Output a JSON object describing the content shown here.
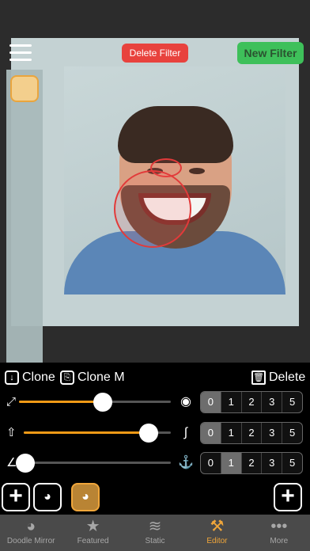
{
  "canvas": {
    "delete_filter_label": "Delete Filter",
    "new_filter_label": "New Filter"
  },
  "tools": {
    "clone_label": "Clone",
    "clone_m_label": "Clone M",
    "delete_label": "Delete"
  },
  "sliders": [
    {
      "id": "size",
      "lead_icon": "resize-arrow-icon",
      "value": 0.55,
      "mid_icon": "face-warp-icon",
      "segments": [
        "0",
        "1",
        "2",
        "3",
        "5"
      ],
      "selected": "0"
    },
    {
      "id": "strength",
      "lead_icon": "up-arrow-icon",
      "value": 0.85,
      "mid_icon": "curve-icon",
      "segments": [
        "0",
        "1",
        "2",
        "3",
        "5"
      ],
      "selected": "0"
    },
    {
      "id": "angle",
      "lead_icon": "angle-icon",
      "value": 0.03,
      "mid_icon": "anchor-icon",
      "segments": [
        "0",
        "1",
        "2",
        "3",
        "5"
      ],
      "selected": "1"
    }
  ],
  "tabs": [
    {
      "label": "Doodle Mirror",
      "icon": "doodle-icon",
      "active": false
    },
    {
      "label": "Featured",
      "icon": "star-icon",
      "active": false
    },
    {
      "label": "Static",
      "icon": "static-icon",
      "active": false
    },
    {
      "label": "Editor",
      "icon": "hammer-icon",
      "active": true
    },
    {
      "label": "More",
      "icon": "more-dots-icon",
      "active": false
    }
  ],
  "colors": {
    "accent": "#f09a16",
    "delete_filter": "#e8423d",
    "new_filter": "#3ec05a"
  }
}
